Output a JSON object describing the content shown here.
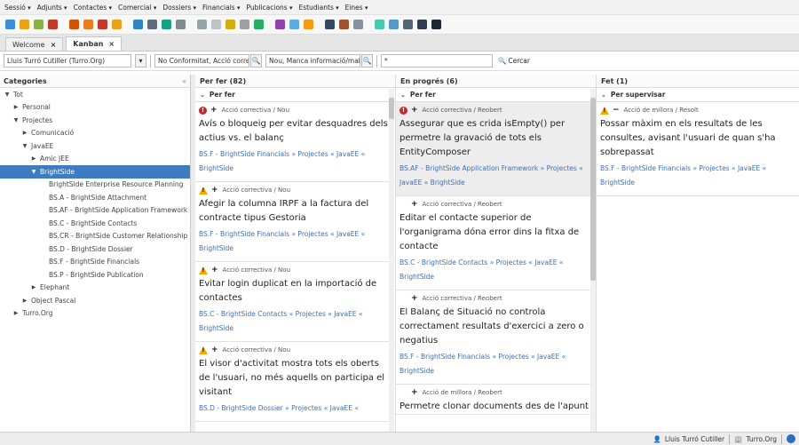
{
  "menu": [
    "Sessió",
    "Adjunts",
    "Contactes",
    "Comercial",
    "Dossiers",
    "Financials",
    "Publicacions",
    "Estudiants",
    "Eines"
  ],
  "toolbar_icons": [
    "user-icon",
    "edit-icon",
    "note-icon",
    "calendar-icon",
    "home-icon",
    "person-icon",
    "target-icon",
    "tag-icon",
    "people-icon",
    "contact-icon",
    "chart-icon",
    "check-icon",
    "document-icon",
    "file-icon",
    "folder-icon",
    "page-icon",
    "grid-icon",
    "notebook-icon",
    "check-list-icon",
    "chart-pen-icon",
    "link-icon",
    "briefcase-icon",
    "archive-icon",
    "kanban-icon",
    "board-icon",
    "bank-icon",
    "help-icon",
    "refresh-icon"
  ],
  "tabs": [
    {
      "label": "Welcome",
      "close": "×"
    },
    {
      "label": "Kanban",
      "close": "×"
    }
  ],
  "filters": {
    "company": "Lluis Turró Cutiller (Turro.Org)",
    "company_arrow": "▾",
    "types": "No Conformitat, Acció corre",
    "status": "Nou, Manca informació/mal",
    "search_value": "*",
    "search_icon": "🔍",
    "search_label": "Cercar"
  },
  "sidebar": {
    "title": "Categories",
    "collapse": "«",
    "items": [
      {
        "label": "Tot",
        "level": 0,
        "arrow": "▼"
      },
      {
        "label": "Personal",
        "level": 1,
        "arrow": "▶"
      },
      {
        "label": "Projectes",
        "level": 1,
        "arrow": "▼"
      },
      {
        "label": "Comunicació",
        "level": 2,
        "arrow": "▶"
      },
      {
        "label": "JavaEE",
        "level": 2,
        "arrow": "▼"
      },
      {
        "label": "Amic JEE",
        "level": 3,
        "arrow": "▶"
      },
      {
        "label": "BrightSide",
        "level": 3,
        "arrow": "▼",
        "selected": true
      },
      {
        "label": "BrightSide Enterprise Resource Planning",
        "level": 4,
        "arrow": ""
      },
      {
        "label": "BS.A - BrightSide Attachment",
        "level": 4,
        "arrow": ""
      },
      {
        "label": "BS.AF - BrightSide Application Framework",
        "level": 4,
        "arrow": ""
      },
      {
        "label": "BS.C - BrightSide Contacts",
        "level": 4,
        "arrow": ""
      },
      {
        "label": "BS.CR - BrightSide Customer Relationship",
        "level": 4,
        "arrow": ""
      },
      {
        "label": "BS.D - BrightSide Dossier",
        "level": 4,
        "arrow": ""
      },
      {
        "label": "BS.F - BrightSide Financials",
        "level": 4,
        "arrow": ""
      },
      {
        "label": "BS.P - BrightSide Publication",
        "level": 4,
        "arrow": ""
      },
      {
        "label": "Elephant",
        "level": 3,
        "arrow": "▶"
      },
      {
        "label": "Object Pascal",
        "level": 2,
        "arrow": "▶"
      },
      {
        "label": "Turro.Org",
        "level": 1,
        "arrow": "▶"
      }
    ]
  },
  "columns": [
    {
      "title": "Per fer (82)",
      "group": "Per fer",
      "cards": [
        {
          "priority": "high",
          "action": "+",
          "meta": "Acció correctiva / Nou",
          "title": "Avís o bloqueig per evitar desquadres dels actius vs. el balanç",
          "project": "BS.F - BrightSide Financials » Projectes « JavaEE « BrightSide"
        },
        {
          "priority": "warn",
          "action": "+",
          "meta": "Acció correctiva / Nou",
          "title": "Afegir la columna IRPF a la factura del contracte tipus Gestoria",
          "project": "BS.F - BrightSide Financials » Projectes « JavaEE « BrightSide"
        },
        {
          "priority": "warn",
          "action": "+",
          "meta": "Acció correctiva / Nou",
          "title": "Evitar login duplicat en la importació de contactes",
          "project": "BS.C - BrightSide Contacts » Projectes « JavaEE « BrightSide"
        },
        {
          "priority": "warn",
          "action": "+",
          "meta": "Acció correctiva / Nou",
          "title": "El visor d'activitat mostra tots els oberts de l'usuari, no més aquells on participa el visitant",
          "project": "BS.D - BrightSide Dossier » Projectes « JavaEE «"
        }
      ]
    },
    {
      "title": "En progrés (6)",
      "group": "Per fer",
      "cards": [
        {
          "priority": "high",
          "action": "+",
          "meta": "Acció correctiva / Reobert",
          "title": "Assegurar que es crida isEmpty() per permetre la gravació de tots els EntityComposer",
          "project": "BS.AF - BrightSide Application Framework » Projectes « JavaEE « BrightSide",
          "selected": true
        },
        {
          "priority": "none",
          "action": "+",
          "meta": "Acció correctiva / Reobert",
          "title": "Editar el contacte superior de l'organigrama dóna error dins la fitxa de contacte",
          "project": "BS.C - BrightSide Contacts » Projectes « JavaEE « BrightSide"
        },
        {
          "priority": "none",
          "action": "+",
          "meta": "Acció correctiva / Reobert",
          "title": "El Balanç de Situació no controla correctament resultats d'exercici a zero o negatius",
          "project": "BS.F - BrightSide Financials » Projectes « JavaEE « BrightSide"
        },
        {
          "priority": "none",
          "action": "+",
          "meta": "Acció de millora / Reobert",
          "title": "Permetre clonar documents des de l'apunt",
          "project": ""
        }
      ]
    },
    {
      "title": "Fet (1)",
      "group": "Per supervisar",
      "cards": [
        {
          "priority": "warn",
          "action": "−",
          "meta": "Acció de millora / Resolt",
          "title": "Possar màxim en els resultats de les consultes, avisant l'usuari de quan s'ha sobrepassat",
          "project": "BS.F - BrightSide Financials » Projectes « JavaEE « BrightSide"
        }
      ]
    }
  ],
  "status": {
    "user": "Lluis Turró Cutiller",
    "org": "Turro.Org"
  },
  "colors": {
    "selection": "#3f7bc1",
    "link": "#3f6fb5",
    "priority_high": "#c62828",
    "priority_warn": "#f2a900"
  }
}
